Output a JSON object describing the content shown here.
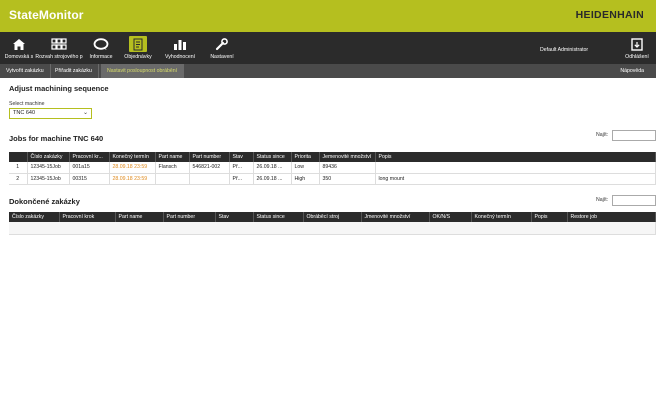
{
  "header": {
    "title": "StateMonitor",
    "brand": "HEIDENHAIN"
  },
  "nav": {
    "items": [
      {
        "label": "Domovská s",
        "icon": "home-icon"
      },
      {
        "label": "Rozvah strojového p",
        "icon": "grid-icon"
      },
      {
        "label": "Informace",
        "icon": "chat-icon"
      },
      {
        "label": "Objednávky",
        "icon": "orders-icon"
      },
      {
        "label": "Vyhodnocení",
        "icon": "bar-chart-icon"
      },
      {
        "label": "Nastavení",
        "icon": "wrench-icon"
      }
    ],
    "user": "Default Administrator",
    "logout": "Odhlášení"
  },
  "subnav": {
    "tabs": [
      "Vytvořit zakázku",
      "Přiřadit zakázku",
      "Nastavit posloupnost obrábění"
    ],
    "help": "Nápověda"
  },
  "adjust": {
    "title": "Adjust machining sequence",
    "select_label": "Select machine",
    "select_value": "TNC 640"
  },
  "jobs": {
    "title": "Jobs for machine  TNC 640",
    "search_label": "Najít:",
    "columns": [
      "",
      "Číslo zakázky",
      "Pracovní kr...",
      "Konečný termín",
      "Part name",
      "Part number",
      "Stav",
      "Status since",
      "Priorita",
      "Jemenovité množství",
      "Popis"
    ],
    "rows": [
      [
        "1",
        "12345-15Job",
        "001a15",
        "28.09.18 23:59",
        "Flansch",
        "546821-002",
        "Př...",
        "26.09.18 ...",
        "Low",
        "89436",
        ""
      ],
      [
        "2",
        "12345-15Job",
        "00315",
        "28.09.18 23:59",
        "",
        "",
        "Př...",
        "26.09.18 ...",
        "High",
        "350",
        "long mount"
      ]
    ]
  },
  "done": {
    "title": "Dokončené zakázky",
    "search_label": "Najít:",
    "columns": [
      "Číslo zakázky",
      "Pracovní krok",
      "Part name",
      "Part number",
      "Stav",
      "Status since",
      "Obráběcí stroj",
      "Jmenovité množství",
      "OK/N/S",
      "Konečný termín",
      "Popis",
      "Restore job"
    ]
  },
  "colors": {
    "accent": "#b5bf1f",
    "nav_bg": "#2b2b2b",
    "deadline": "#e08a1c"
  }
}
